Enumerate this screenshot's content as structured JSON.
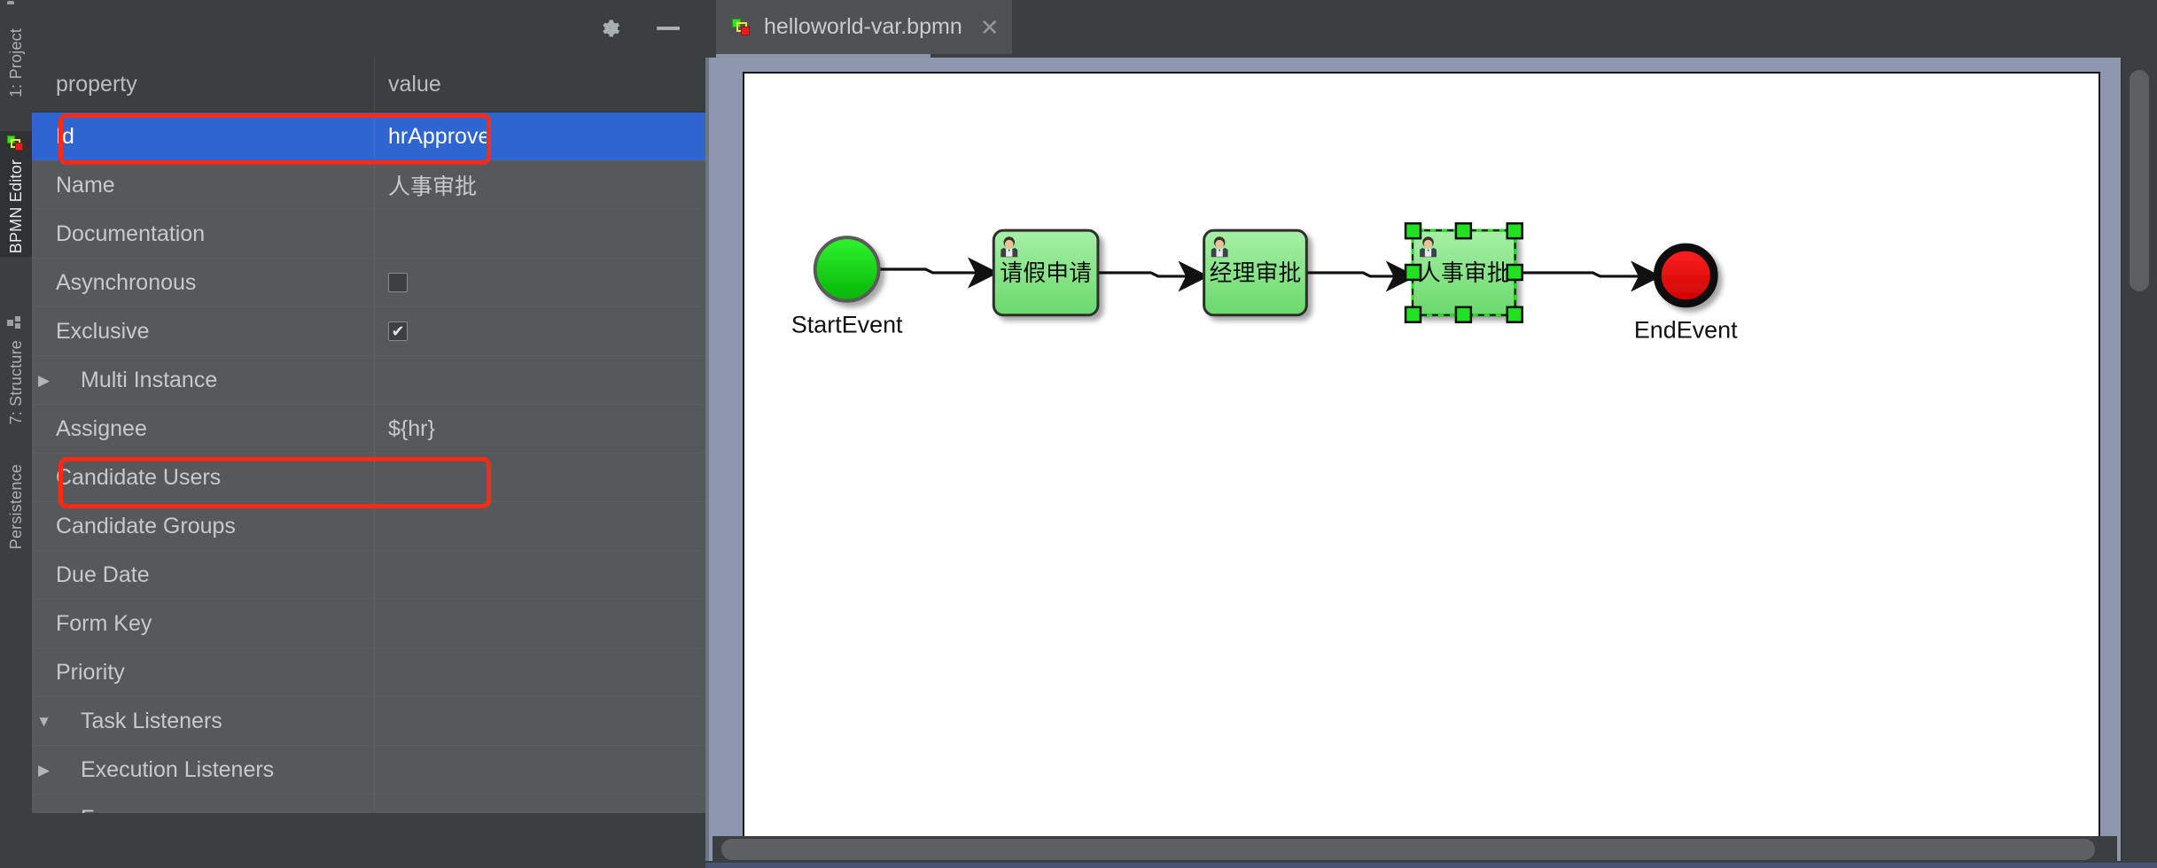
{
  "toolstrip": {
    "tabs": [
      {
        "label": "1: Project",
        "icon": "folder-icon",
        "active": false
      },
      {
        "label": "BPMN Editor",
        "icon": "bpmn-icon",
        "active": true
      },
      {
        "label": "7: Structure",
        "icon": "structure-icon",
        "active": false
      },
      {
        "label": "Persistence",
        "icon": "none",
        "active": false
      }
    ]
  },
  "property_panel": {
    "toolbar": {
      "settings_icon": "gear-icon",
      "minimize_icon": "minimize-icon"
    },
    "columns": {
      "property": "property",
      "value": "value"
    },
    "rows": [
      {
        "name": "Id",
        "value": "hrApprove",
        "type": "text",
        "twisty": "",
        "selected": true,
        "highlighted": true
      },
      {
        "name": "Name",
        "value": "人事审批",
        "type": "text",
        "twisty": "",
        "selected": false,
        "highlighted": false
      },
      {
        "name": "Documentation",
        "value": "",
        "type": "text",
        "twisty": "",
        "selected": false,
        "highlighted": false
      },
      {
        "name": "Asynchronous",
        "value": "",
        "type": "checkbox",
        "checked": false,
        "twisty": "",
        "selected": false,
        "highlighted": false
      },
      {
        "name": "Exclusive",
        "value": "",
        "type": "checkbox",
        "checked": true,
        "twisty": "",
        "selected": false,
        "highlighted": false
      },
      {
        "name": "Multi Instance",
        "value": "",
        "type": "text",
        "twisty": "collapsed",
        "selected": false,
        "highlighted": false
      },
      {
        "name": "Assignee",
        "value": "${hr}",
        "type": "text",
        "twisty": "",
        "selected": false,
        "highlighted": true
      },
      {
        "name": "Candidate Users",
        "value": "",
        "type": "text",
        "twisty": "",
        "selected": false,
        "highlighted": false
      },
      {
        "name": "Candidate Groups",
        "value": "",
        "type": "text",
        "twisty": "",
        "selected": false,
        "highlighted": false
      },
      {
        "name": "Due Date",
        "value": "",
        "type": "text",
        "twisty": "",
        "selected": false,
        "highlighted": false
      },
      {
        "name": "Form Key",
        "value": "",
        "type": "text",
        "twisty": "",
        "selected": false,
        "highlighted": false
      },
      {
        "name": "Priority",
        "value": "",
        "type": "text",
        "twisty": "",
        "selected": false,
        "highlighted": false
      },
      {
        "name": "Task Listeners",
        "value": "",
        "type": "text",
        "twisty": "expanded",
        "selected": false,
        "highlighted": false
      },
      {
        "name": "Execution Listeners",
        "value": "",
        "type": "text",
        "twisty": "collapsed",
        "selected": false,
        "highlighted": false
      },
      {
        "name": "Form",
        "value": "",
        "type": "text",
        "twisty": "collapsed",
        "selected": false,
        "highlighted": false
      }
    ],
    "highlight_color": "#ff2a15",
    "selection_color": "#2f65d0"
  },
  "editor": {
    "tab": {
      "title": "helloworld-var.bpmn",
      "icon": "bpmn-file-icon",
      "close_icon": "close-icon"
    },
    "diagram": {
      "title": "helloworld-var",
      "nodes": [
        {
          "id": "startEvent",
          "kind": "start-event",
          "label": "StartEvent",
          "label_position": "below",
          "fill": "#19d419",
          "stroke": "#4b4b4b"
        },
        {
          "id": "task1",
          "kind": "user-task",
          "label": "请假申请",
          "label_position": "inside",
          "fill": "#8be68b",
          "stroke": "#2d2d2d",
          "selected": false
        },
        {
          "id": "task2",
          "kind": "user-task",
          "label": "经理审批",
          "label_position": "inside",
          "fill": "#8be68b",
          "stroke": "#2d2d2d",
          "selected": false
        },
        {
          "id": "task3",
          "kind": "user-task",
          "label": "人事审批",
          "label_position": "inside",
          "fill": "#8be68b",
          "stroke": "#2d2d2d",
          "selected": true
        },
        {
          "id": "endEvent",
          "kind": "end-event",
          "label": "EndEvent",
          "label_position": "below",
          "fill": "#ef0d0d",
          "stroke": "#111111"
        }
      ],
      "flows": [
        {
          "from": "startEvent",
          "to": "task1"
        },
        {
          "from": "task1",
          "to": "task2"
        },
        {
          "from": "task2",
          "to": "task3"
        },
        {
          "from": "task3",
          "to": "endEvent"
        }
      ],
      "selection_handle_color": "#22e022"
    },
    "scrollbars": {
      "vertical": "vertical-scrollbar",
      "horizontal": "horizontal-scrollbar"
    }
  }
}
